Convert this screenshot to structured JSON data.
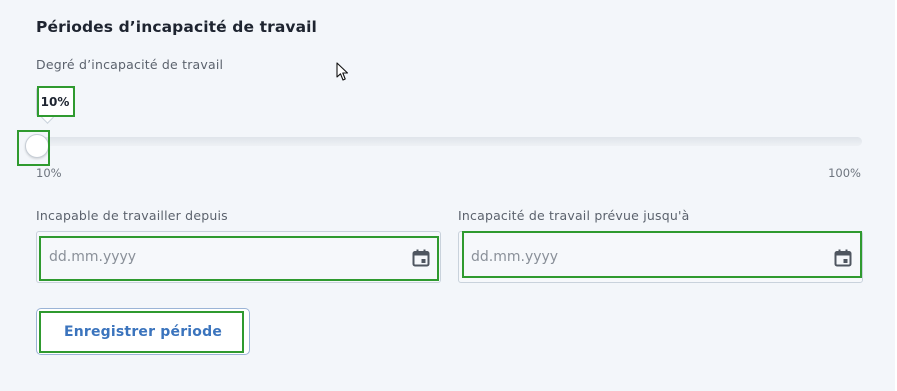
{
  "section": {
    "title": "Périodes d’incapacité de travail"
  },
  "slider": {
    "label": "Degré d’incapacité de travail",
    "value_display": "10%",
    "value": 10,
    "min": 10,
    "max": 100,
    "min_label": "10%",
    "max_label": "100%"
  },
  "from_field": {
    "label": "Incapable de travailler depuis",
    "placeholder": "dd.mm.yyyy",
    "value": ""
  },
  "until_field": {
    "label": "Incapacité de travail prévue jusqu'à",
    "placeholder": "dd.mm.yyyy",
    "value": ""
  },
  "save_button": {
    "label": "Enregistrer période"
  },
  "icons": {
    "calendar": "calendar-icon",
    "cursor": "mouse-pointer-icon"
  },
  "colors": {
    "accent": "#3b74bd",
    "highlight": "#2f9a2f",
    "background": "#f3f6fa"
  }
}
